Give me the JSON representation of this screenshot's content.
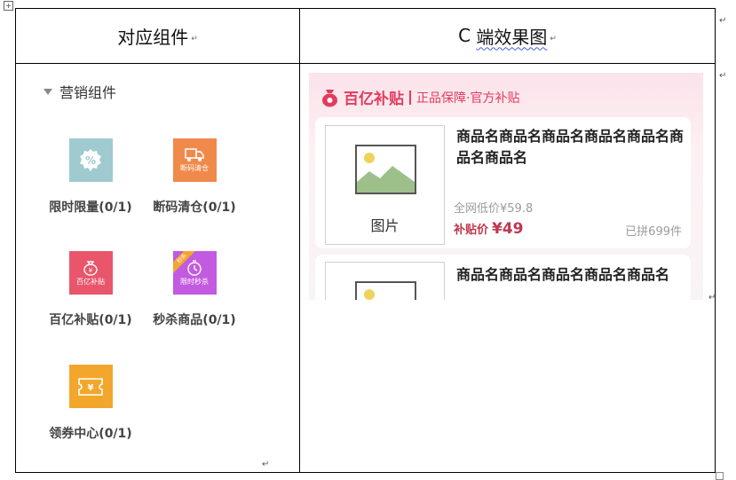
{
  "table": {
    "col1_header": "对应组件",
    "col2_header_prefix": "C ",
    "col2_header_word": "端效果图",
    "para_mark": "↵"
  },
  "left": {
    "group_title": "营销组件",
    "components": [
      {
        "label": "限时限量(0/1)",
        "icon": "percent-badge-icon",
        "color": "#9fcad0"
      },
      {
        "label": "断码清仓(0/1)",
        "icon": "clearance-truck-icon",
        "icon_text": "断码清仓",
        "color": "#f08a4b"
      },
      {
        "label": "百亿补贴(0/1)",
        "icon": "money-bag-icon",
        "icon_text": "百亿补贴",
        "color": "#e9566c"
      },
      {
        "label": "秒杀商品(0/1)",
        "icon": "stopwatch-icon",
        "icon_text": "限时秒杀",
        "tag": "秒杀",
        "color": "#c25be0"
      },
      {
        "label": "领券中心(0/1)",
        "icon": "coupon-ticket-icon",
        "color": "#f2a72c"
      }
    ]
  },
  "preview": {
    "brand_title": "百亿补贴",
    "brand_subtitle": "正品保障·官方补贴",
    "products": [
      {
        "image_label": "图片",
        "name": "商品名商品名商品名商品名商品名商品名商品名",
        "market_price": "全网低价¥59.8",
        "price_label": "补贴价",
        "price": "¥49",
        "sold": "已拼699件"
      },
      {
        "name": "商品名商品名商品名商品名商品名"
      }
    ],
    "accent_color": "#e23b5e"
  }
}
